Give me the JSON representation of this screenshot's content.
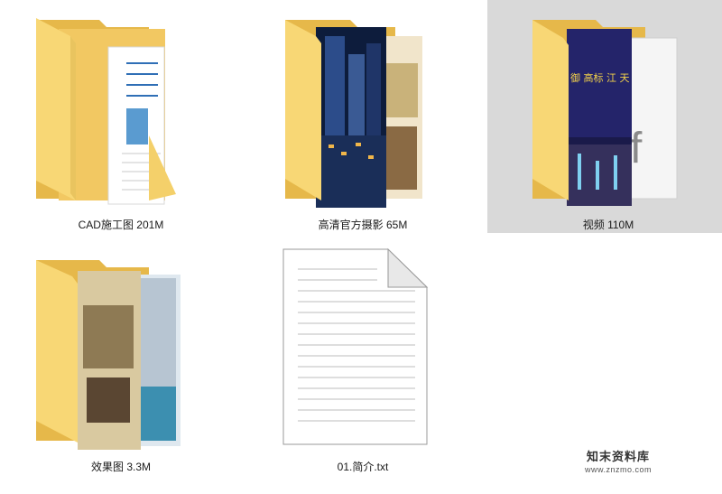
{
  "files": [
    {
      "label": "CAD施工图 201M",
      "type": "folder",
      "preview": "document",
      "selected": false
    },
    {
      "label": "高清官方摄影 65M",
      "type": "folder",
      "preview": "photos",
      "selected": false
    },
    {
      "label": "视频 110M",
      "type": "folder",
      "preview": "video",
      "selected": true
    },
    {
      "label": "效果图 3.3M",
      "type": "folder",
      "preview": "renderings",
      "selected": false
    },
    {
      "label": "01.简介.txt",
      "type": "text-file",
      "preview": "lined-page",
      "selected": false
    }
  ],
  "video_poster_text": "御 高标 江 天",
  "watermark": {
    "name": "知末资料库",
    "url": "www.znzmo.com"
  },
  "colors": {
    "folder_back": "#e6b84a",
    "folder_front": "#f8d775",
    "selection": "#d9d9d9"
  }
}
